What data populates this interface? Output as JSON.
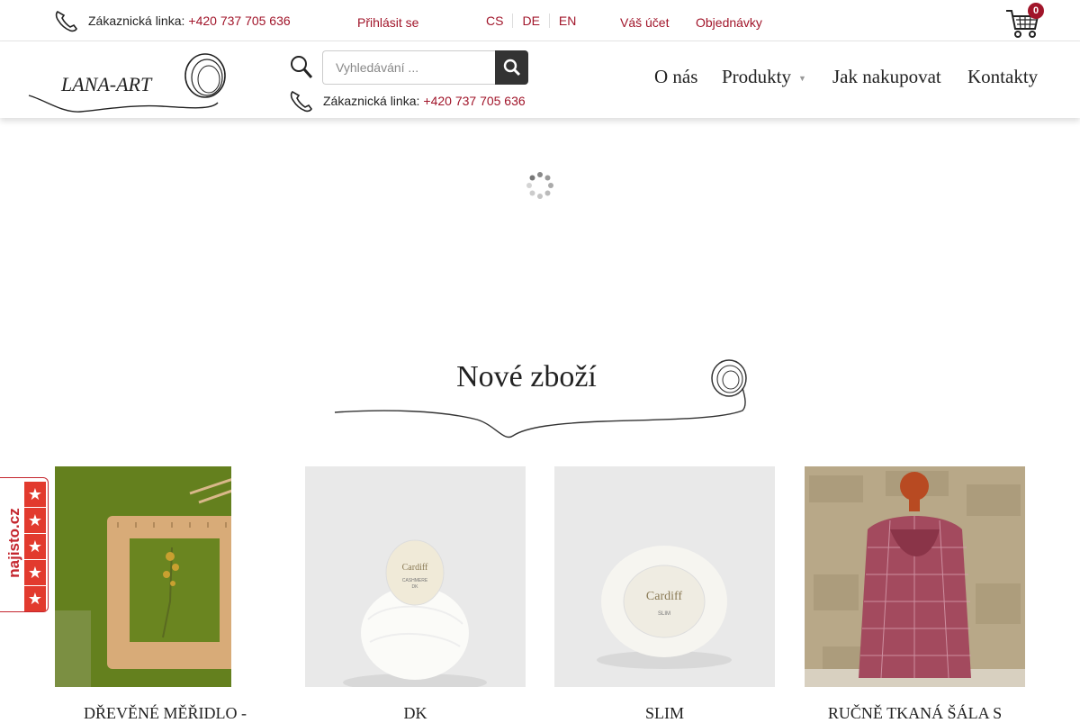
{
  "topbar": {
    "phone_label": "Zákaznická linka:",
    "phone_number": "+420 737 705 636",
    "login": " Přihlásit se",
    "languages": [
      "CS",
      "DE",
      "EN"
    ],
    "account": "Váš účet",
    "orders": "Objednávky",
    "cart_count": "0"
  },
  "header": {
    "logo_text": "LANA-ART",
    "search_placeholder": "Vyhledávání ...",
    "phone_label": "Zákaznická linka:",
    "phone_number": "+420 737 705 636",
    "nav": {
      "about": "O nás",
      "products": "Produkty",
      "how_to_buy": "Jak nakupovat",
      "contacts": "Kontakty"
    }
  },
  "section": {
    "title": "Nové zboží"
  },
  "products": [
    {
      "name": "DŘEVĚNÉ MĚŘIDLO -"
    },
    {
      "name": "DK"
    },
    {
      "name": "SLIM"
    },
    {
      "name": "RUČNĚ TKANÁ ŠÁLA S"
    }
  ],
  "badge": {
    "text": "najisto.cz"
  },
  "colors": {
    "accent": "#a1152a",
    "badge_red": "#c4262e"
  }
}
